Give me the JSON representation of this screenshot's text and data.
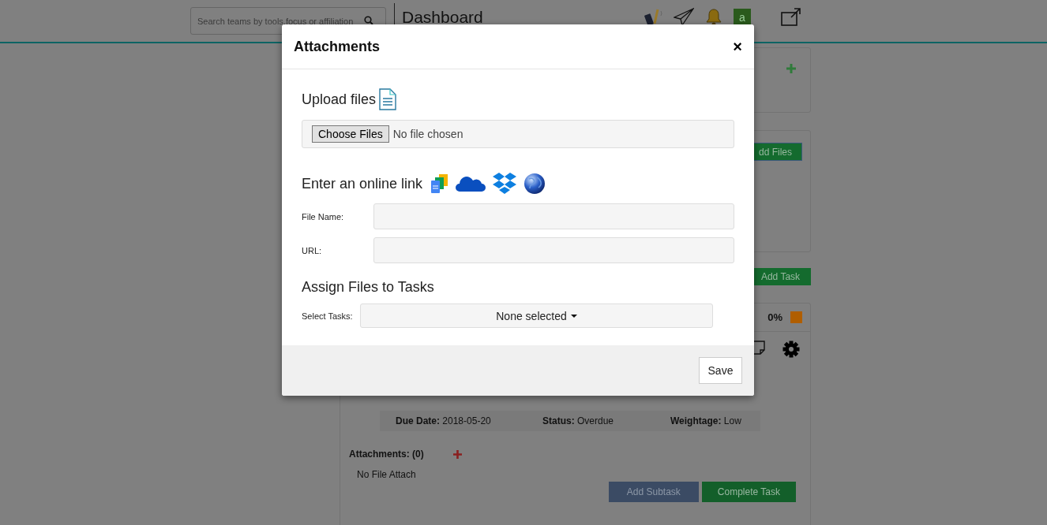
{
  "header": {
    "search": {
      "placeholder": "Search teams by tools,focus or affiliation"
    },
    "title": "Dashboard",
    "avatar": "a"
  },
  "board": {
    "add_files_button": "dd Files",
    "add_task_button": "Add Task",
    "task": {
      "progress": "0%",
      "details": [
        {
          "label": "Due Date:",
          "value": "2018-05-20"
        },
        {
          "label": "Status:",
          "value": "Overdue"
        },
        {
          "label": "Weightage:",
          "value": "Low"
        }
      ],
      "attachments_label": "Attachments: (0)",
      "empty_note": "No File Attach",
      "buttons": [
        {
          "label": "Add Subtask",
          "kind": "secondary"
        },
        {
          "label": "Complete Task",
          "kind": "success"
        }
      ]
    }
  },
  "modal": {
    "title": "Attachments",
    "close": "×",
    "upload": {
      "heading": "Upload files",
      "button": "Choose Files",
      "status": "No file chosen"
    },
    "link": {
      "heading": "Enter an online link",
      "fields": [
        {
          "label": "File Name:"
        },
        {
          "label": "URL:"
        }
      ]
    },
    "assign": {
      "heading": "Assign Files to Tasks",
      "label": "Select Tasks:",
      "value": "None selected"
    },
    "save": "Save"
  }
}
